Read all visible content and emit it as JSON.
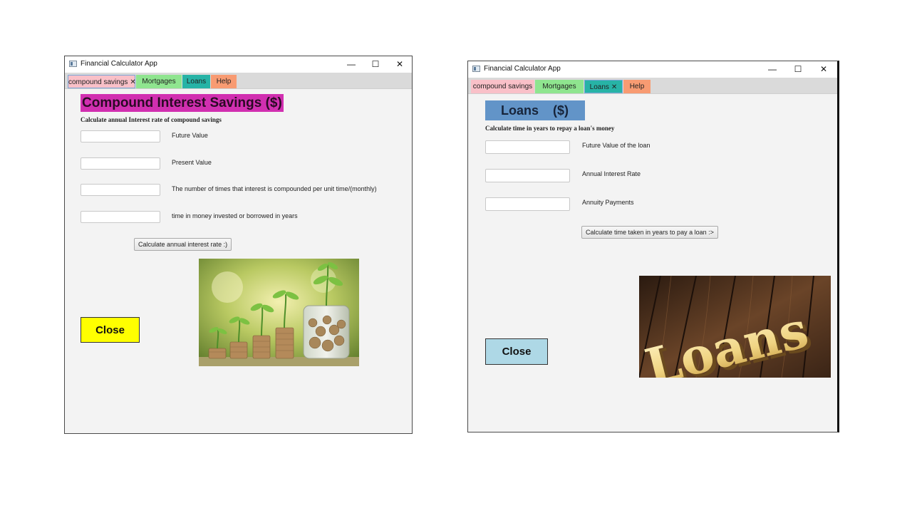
{
  "windows": [
    {
      "title": "Financial Calculator App",
      "controls": {
        "minimize": "—",
        "maximize": "☐",
        "close": "✕"
      },
      "tabs": [
        {
          "label": "compound savings",
          "close": "✕",
          "color": "#f9c0c8",
          "selected": true
        },
        {
          "label": "Mortgages",
          "close": "",
          "color": "#8fe58f",
          "selected": false
        },
        {
          "label": "Loans",
          "close": "",
          "color": "#27b3a6",
          "selected": false
        },
        {
          "label": "Help",
          "close": "",
          "color": "#f89b72",
          "selected": false
        }
      ],
      "heading": "Compound Interest Savings ($)",
      "heading_bg": "#d12fb0",
      "subheading": "Calculate annual Interest rate of compound savings",
      "fields": [
        {
          "label": "Future Value",
          "value": ""
        },
        {
          "label": "Present Value",
          "value": ""
        },
        {
          "label": "The number of times that interest is compounded per unit time/(monthly)",
          "value": ""
        },
        {
          "label": "time in money invested or borrowed in years",
          "value": ""
        }
      ],
      "action_button": "Calculate annual interest rate :)",
      "close_button": "Close",
      "close_color": "#ffff00",
      "image_icon": "coins-plant-image"
    },
    {
      "title": "Financial Calculator App",
      "controls": {
        "minimize": "—",
        "maximize": "☐",
        "close": "✕"
      },
      "tabs": [
        {
          "label": "compound savings",
          "close": "",
          "color": "#f9c0c8",
          "selected": false
        },
        {
          "label": "Mortgages",
          "close": "",
          "color": "#8fe58f",
          "selected": false
        },
        {
          "label": "Loans",
          "close": "✕",
          "color": "#27b3a6",
          "selected": true
        },
        {
          "label": "Help",
          "close": "",
          "color": "#f89b72",
          "selected": false
        }
      ],
      "heading": "Loans    ($)",
      "heading_bg": "#6294c8",
      "subheading": "Calculate time in years to repay a loan's money",
      "fields": [
        {
          "label": "Future Value of the loan",
          "value": ""
        },
        {
          "label": "Annual Interest Rate",
          "value": ""
        },
        {
          "label": "Annuity Payments",
          "value": ""
        }
      ],
      "action_button": "Calculate time taken in years to pay a loan :>",
      "close_button": "Close",
      "close_color": "#aed8e6",
      "image_text": "Loans",
      "image_icon": "loans-wood-image"
    }
  ]
}
